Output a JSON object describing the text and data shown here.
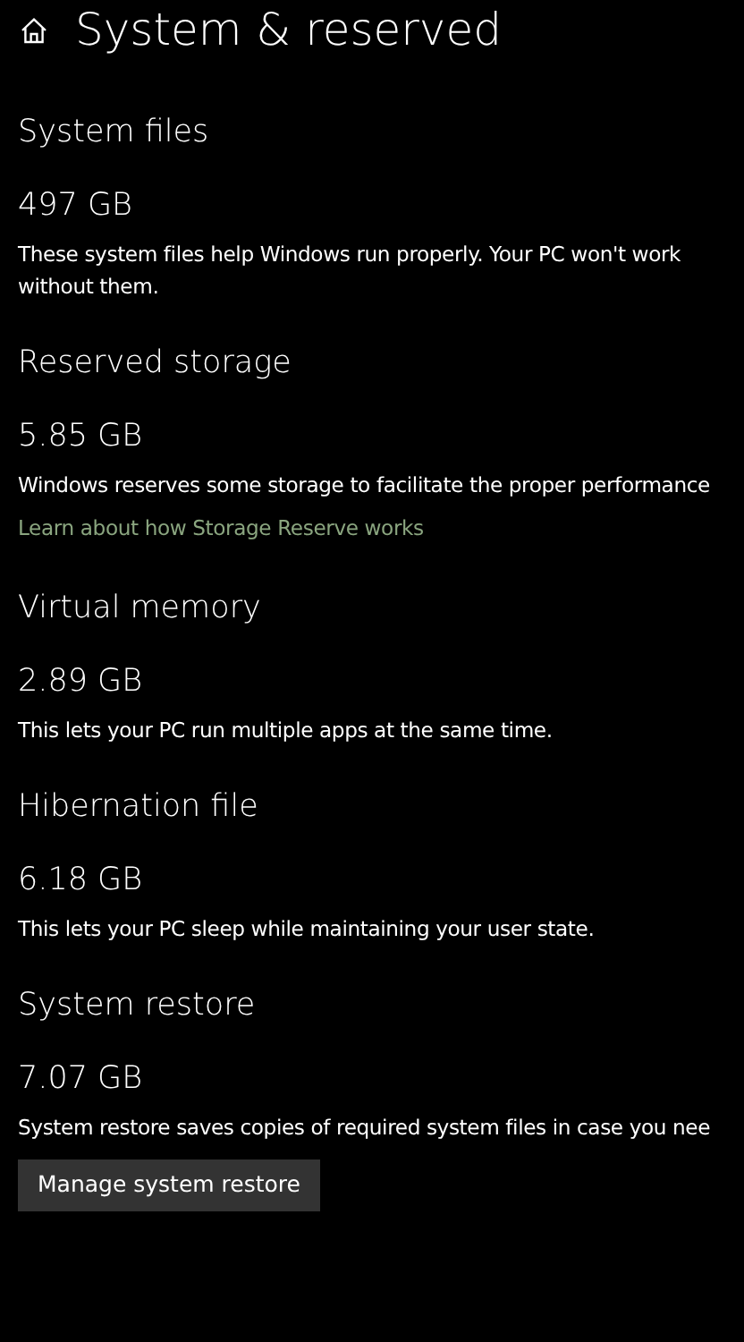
{
  "page": {
    "title": "System & reserved"
  },
  "sections": [
    {
      "heading": "System files",
      "size": "497 GB",
      "description": "These system files help Windows run properly. Your PC won't work without them."
    },
    {
      "heading": "Reserved storage",
      "size": "5.85 GB",
      "description": "Windows reserves some storage to facilitate the proper performance",
      "link": "Learn about how Storage Reserve works"
    },
    {
      "heading": "Virtual memory",
      "size": "2.89 GB",
      "description": "This lets your PC run multiple apps at the same time."
    },
    {
      "heading": "Hibernation file",
      "size": "6.18 GB",
      "description": "This lets your PC sleep while maintaining your user state."
    },
    {
      "heading": "System restore",
      "size": "7.07 GB",
      "description": "System restore saves copies of required system files in case you nee",
      "button": "Manage system restore"
    }
  ]
}
